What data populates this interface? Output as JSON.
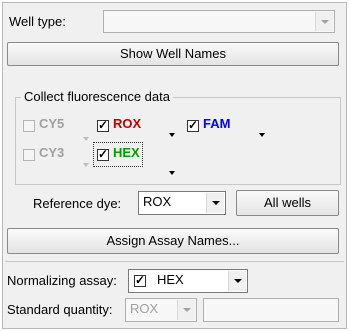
{
  "well_type": {
    "label": "Well type:",
    "value": ""
  },
  "show_well_names": {
    "label": "Show Well Names"
  },
  "collect": {
    "title": "Collect fluorescence data",
    "dyes": [
      {
        "name": "CY5",
        "checked": false,
        "enabled": false,
        "color": "#a0a0a0"
      },
      {
        "name": "ROX",
        "checked": true,
        "enabled": true,
        "color": "#c00000"
      },
      {
        "name": "FAM",
        "checked": true,
        "enabled": true,
        "color": "#0000ff"
      },
      {
        "name": "CY3",
        "checked": false,
        "enabled": false,
        "color": "#a0a0a0"
      },
      {
        "name": "HEX",
        "checked": true,
        "enabled": true,
        "color": "#00a000"
      }
    ]
  },
  "reference_dye": {
    "label": "Reference dye:",
    "value": "ROX"
  },
  "all_wells": {
    "label": "All wells"
  },
  "assign_assay": {
    "label": "Assign Assay Names..."
  },
  "normalizing_assay": {
    "label": "Normalizing assay:",
    "checked": true,
    "value": "HEX"
  },
  "standard_quantity": {
    "label": "Standard quantity:",
    "value": "ROX",
    "enabled": false
  }
}
